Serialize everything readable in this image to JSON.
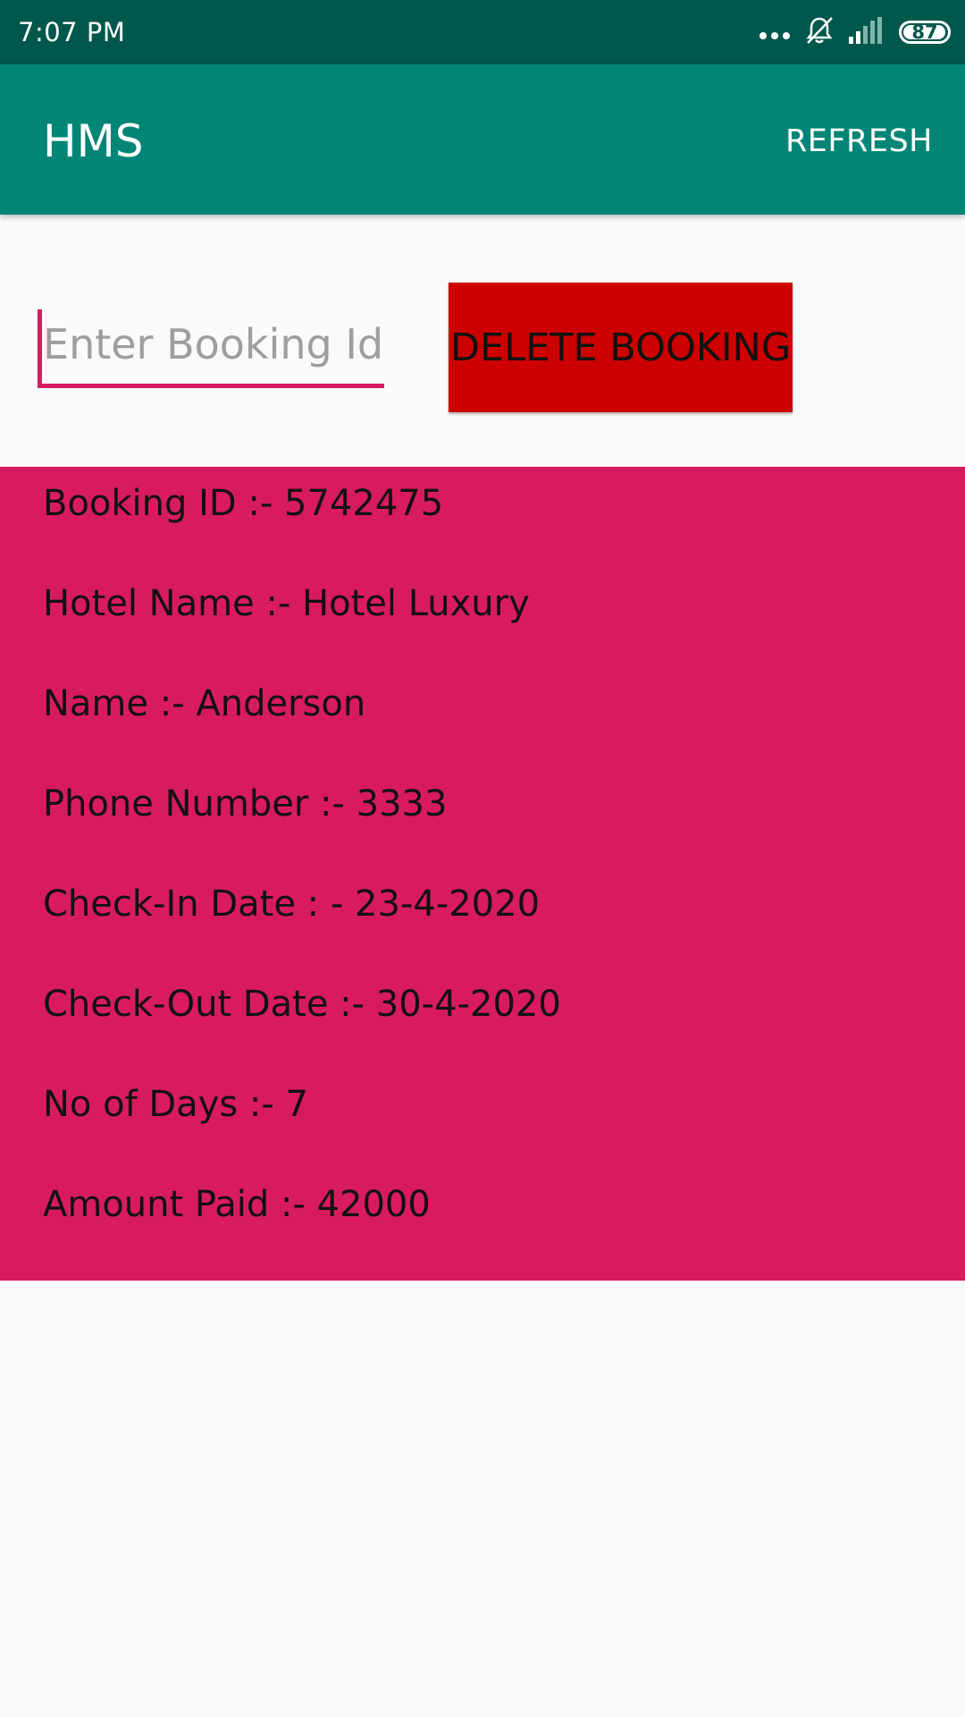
{
  "status_bar": {
    "time": "7:07 PM",
    "battery_level": "87",
    "icons": [
      "more-dots-icon",
      "bell-muted-icon",
      "signal-icon",
      "battery-icon"
    ]
  },
  "app_bar": {
    "title": "HMS",
    "refresh_label": "REFRESH"
  },
  "booking_input": {
    "placeholder": "Enter Booking Id",
    "value": ""
  },
  "delete_button": {
    "label": "DELETE BOOKING"
  },
  "details": {
    "lines": [
      "Booking ID :- 5742475",
      "Hotel Name :- Hotel Luxury",
      "Name :- Anderson",
      "Phone Number :- 3333",
      "Check-In Date : - 23-4-2020",
      "Check-Out Date :- 30-4-2020",
      "No of Days :- 7",
      "Amount Paid :- 42000"
    ]
  },
  "colors": {
    "status_bar": "#00574B",
    "app_bar": "#008577",
    "accent": "#D81B60",
    "delete_button": "#CC0000",
    "background": "#FAFAFA"
  }
}
